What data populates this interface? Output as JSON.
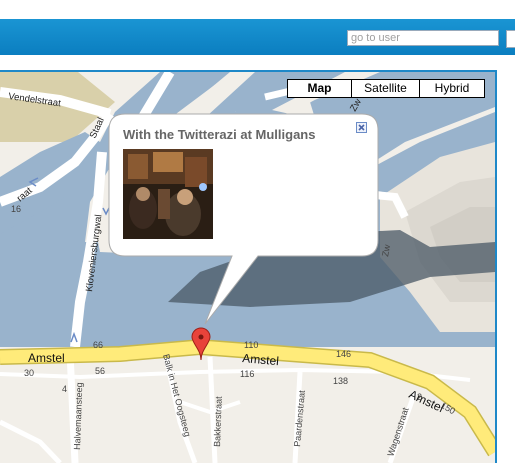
{
  "search": {
    "placeholder": "go to user"
  },
  "map_type_buttons": [
    {
      "label": "Map",
      "selected": true
    },
    {
      "label": "Satellite",
      "selected": false
    },
    {
      "label": "Hybrid",
      "selected": false
    }
  ],
  "info_window": {
    "title": "With the Twitterazi at Mulligans"
  },
  "street_labels": {
    "vendelstraat": "Vendelstraat",
    "staal": "Staal",
    "raat": "raat",
    "zw": "Zw",
    "kloveniersburgwal": "Kloveniersburgwal",
    "amstel_1": "Amstel",
    "amstel_2": "Amstel",
    "amstel_3": "Amstel",
    "halvemaansteeg": "Halvemaansteeg",
    "balk_in_het_oogsteeg": "Balk in Het Oogsteeg",
    "bakkerstraat": "Bakkerstraat",
    "paardenstraat": "Paardenstraat",
    "wagenstraat": "Wagenstraat",
    "amstel_side": "Amstel"
  },
  "house_numbers": {
    "n16": "16",
    "n66": "66",
    "n56": "56",
    "n30": "30",
    "n4": "4",
    "n110": "110",
    "n116": "116",
    "n146": "146",
    "n138": "138",
    "n2": "2",
    "n150": "150"
  },
  "colors": {
    "water": "#99b3cc",
    "land": "#f2efe9",
    "road": "#ffffff",
    "main_road": "#ffeb7a",
    "park": "#d9d0aa",
    "topbar": "#1a95d3",
    "marker": "#e8433a"
  },
  "icons": {
    "marker": "red-map-pin",
    "close": "close-x-box"
  }
}
